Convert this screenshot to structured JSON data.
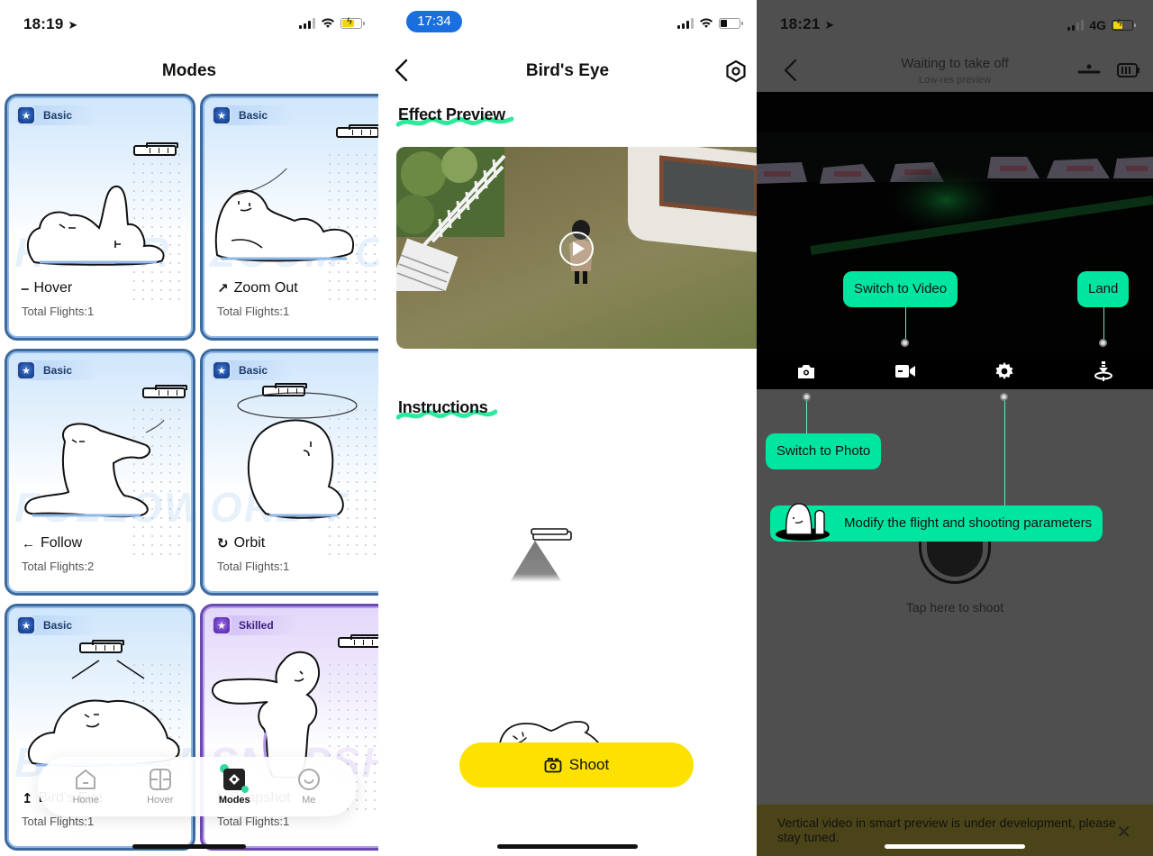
{
  "modes_screen": {
    "status": {
      "time": "18:19",
      "battery_color": "#f5d60a"
    },
    "title": "Modes",
    "cards": [
      {
        "level": "Basic",
        "name": "Hover",
        "icon": "hover-icon",
        "glyph": "⎯",
        "flights": "Total Flights:1",
        "watermark": "HOVER"
      },
      {
        "level": "Basic",
        "name": "Zoom Out",
        "icon": "zoom-out-icon",
        "glyph": "↗",
        "flights": "Total Flights:1",
        "watermark": "ZOOM OUT"
      },
      {
        "level": "Basic",
        "name": "Follow",
        "icon": "follow-icon",
        "glyph": "←",
        "flights": "Total Flights:2",
        "watermark": "FOLLOW"
      },
      {
        "level": "Basic",
        "name": "Orbit",
        "icon": "orbit-icon",
        "glyph": "↻",
        "flights": "Total Flights:1",
        "watermark": "ORBIT"
      },
      {
        "level": "Basic",
        "name": "Bird's Eye",
        "icon": "birds-eye-icon",
        "glyph": "↥",
        "flights": "Total Flights:1",
        "watermark": "BIRD'S EYE"
      },
      {
        "level": "Skilled",
        "name": "Snapshot",
        "icon": "snapshot-icon",
        "glyph": "ϟ",
        "flights": "Total Flights:1",
        "watermark": "SNAPSHOT"
      }
    ],
    "tabbar": [
      {
        "label": "Home",
        "icon": "home-icon",
        "active": false
      },
      {
        "label": "Hover",
        "icon": "hover-tab-icon",
        "active": false
      },
      {
        "label": "Modes",
        "icon": "modes-icon",
        "active": true
      },
      {
        "label": "Me",
        "icon": "smiley-icon",
        "active": false
      }
    ],
    "colors": {
      "basic_border": "#3d6a9c",
      "skilled_border": "#6b4ab0",
      "accent": "#2ddc9a"
    }
  },
  "birds_eye_screen": {
    "status": {
      "time": "17:34",
      "time_pill_color": "#1a6fe0"
    },
    "title": "Bird's Eye",
    "effect_preview_heading": "Effect Preview",
    "instructions_heading": "Instructions",
    "shoot_label": "Shoot",
    "colors": {
      "shoot_button": "#fde100",
      "squiggle": "#2ee89c"
    }
  },
  "camera_screen": {
    "status": {
      "time": "18:21",
      "network": "4G",
      "battery_color": "#f5d60a"
    },
    "title": "Waiting to take off",
    "subtitle": "Low-res preview",
    "tooltips": {
      "switch_to_video": "Switch to Video",
      "land": "Land",
      "switch_to_photo": "Switch to Photo",
      "modify_params": "Modify the flight and shooting parameters"
    },
    "tap_to_shoot": "Tap here to shoot",
    "banner_text": "Vertical video in smart preview is under development, please stay tuned.",
    "colors": {
      "tooltip": "#00e5a0",
      "overlay": "#4f4f4f",
      "banner": "#4b4418"
    }
  }
}
